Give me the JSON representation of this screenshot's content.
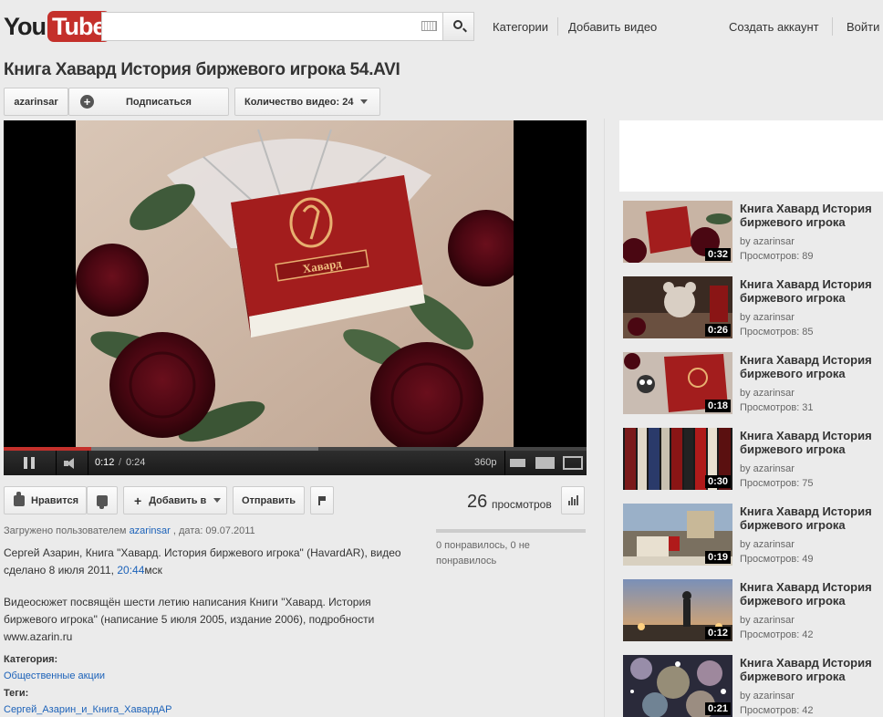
{
  "header": {
    "logo_you": "You",
    "logo_tube": "Tube",
    "search_placeholder": "",
    "nav_categories": "Категории",
    "nav_upload": "Добавить видео",
    "nav_create_account": "Создать аккаунт",
    "nav_sign_in": "Войти"
  },
  "video": {
    "title": "Книга Хавард История биржевого игрока 54.AVI",
    "channel": "azarinsar",
    "subscribe_label": "Подписаться",
    "video_count_label": "Количество видео: 24",
    "book_title": "Хавард"
  },
  "player": {
    "current_time": "0:12",
    "separator": "/",
    "duration": "0:24",
    "quality": "360p",
    "progress_played_fraction": 0.15,
    "progress_loaded_fraction": 0.54
  },
  "actions": {
    "like_label": "Нравится",
    "add_label": "Добавить в",
    "share_label": "Отправить",
    "view_count": "26",
    "views_label": "просмотров"
  },
  "description": {
    "uploaded_prefix": "Загружено пользователем",
    "uploader": "azarinsar",
    "date_text": ", дата: 09.07.2011",
    "line1_a": "Сергей Азарин, Книга \"Хавард. История биржевого игрока\" (HavardAR), видео сделано 8 июля 2011, ",
    "line1_time": "20:44",
    "line1_b": "мск",
    "line2": "Видеосюжет посвящён шести летию написания Книги \"Хавард. История биржевого игрока\" (написание 5 июля 2005, издание 2006), подробности www.azarin.ru",
    "category_label": "Категория:",
    "category_value": "Общественные акции",
    "tags_label": "Теги:",
    "tags_value": "Сергей_Азарин_и_Книга_ХавардАР",
    "likes_text": "0 понравилось, 0 не понравилось"
  },
  "related": [
    {
      "title": "Книга Хавард История биржевого игрока",
      "by": "by azarinsar",
      "views": "Просмотров: 89",
      "duration": "0:32"
    },
    {
      "title": "Книга Хавард История биржевого игрока",
      "by": "by azarinsar",
      "views": "Просмотров: 85",
      "duration": "0:26"
    },
    {
      "title": "Книга Хавард История биржевого игрока",
      "by": "by azarinsar",
      "views": "Просмотров: 31",
      "duration": "0:18"
    },
    {
      "title": "Книга Хавард История биржевого игрока",
      "by": "by azarinsar",
      "views": "Просмотров: 75",
      "duration": "0:30"
    },
    {
      "title": "Книга Хавард История биржевого игрока",
      "by": "by azarinsar",
      "views": "Просмотров: 49",
      "duration": "0:19"
    },
    {
      "title": "Книга Хавард История биржевого игрока",
      "by": "by azarinsar",
      "views": "Просмотров: 42",
      "duration": "0:12"
    },
    {
      "title": "Книга Хавард История биржевого игрока",
      "by": "by azarinsar",
      "views": "Просмотров: 42",
      "duration": "0:21"
    }
  ],
  "colors": {
    "brand_red": "#c4302b",
    "link_blue": "#1c62b9",
    "background": "#ebebeb"
  }
}
